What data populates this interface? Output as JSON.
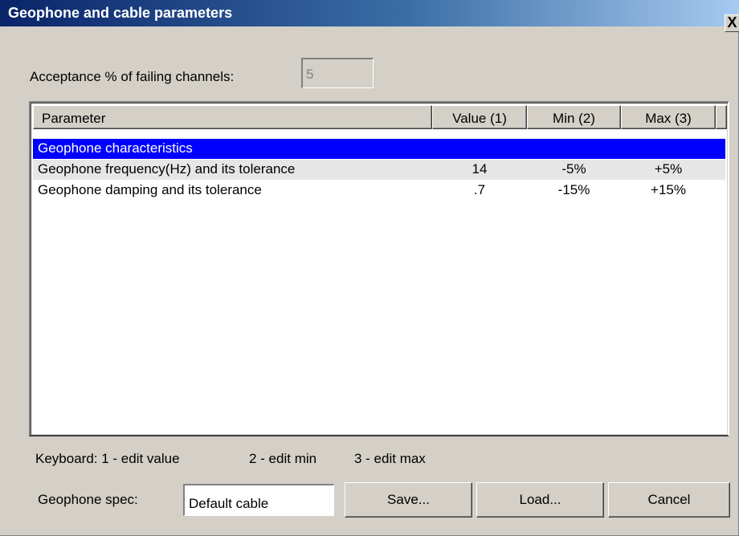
{
  "window": {
    "title": "Geophone and cable parameters",
    "close_glyph": "X",
    "close_icon": "close-icon"
  },
  "acceptance": {
    "label": "Acceptance % of failing channels:",
    "value": "5"
  },
  "table": {
    "headers": [
      "Parameter",
      "Value (1)",
      "Min (2)",
      "Max (3)"
    ],
    "group_label": "Geophone characteristics",
    "rows": [
      {
        "parameter": "Geophone frequency(Hz) and its tolerance",
        "value": "14",
        "min": "-5%",
        "max": "+5%"
      },
      {
        "parameter": "Geophone damping and its tolerance",
        "value": ".7",
        "min": "-15%",
        "max": "+15%"
      }
    ]
  },
  "keyboard_hints": [
    "Keyboard:  1 - edit value",
    "2 - edit min",
    "3 -  edit max"
  ],
  "geophone_spec": {
    "label": "Geophone spec:",
    "value": "Default cable"
  },
  "buttons": {
    "save": "Save...",
    "load": "Load...",
    "cancel": "Cancel"
  },
  "colors": {
    "selection": "#0000ff",
    "dialog_face": "#d4d0c8",
    "titlebar_start": "#0a246a",
    "titlebar_end": "#a6caf0"
  }
}
